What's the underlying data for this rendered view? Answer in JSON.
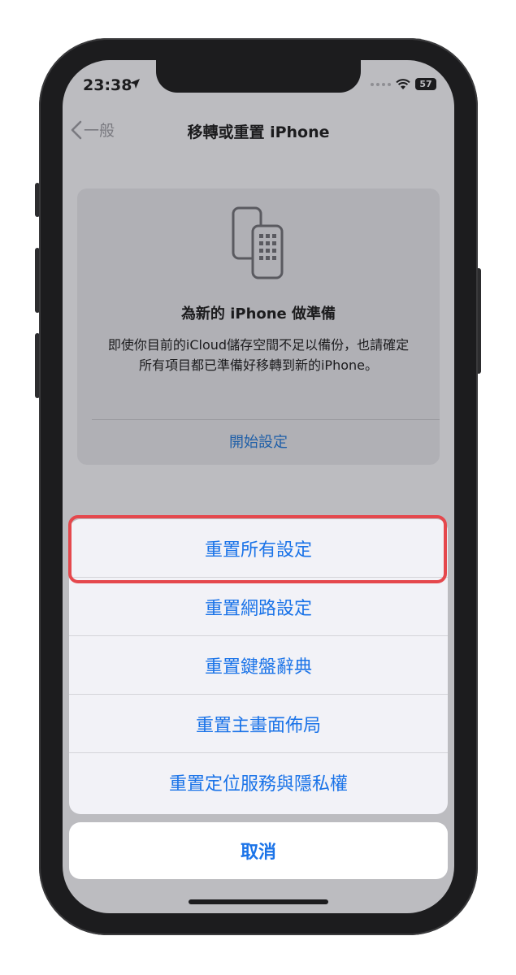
{
  "status_bar": {
    "time": "23:38",
    "battery": "57",
    "location_icon": "location-arrow-icon",
    "wifi_icon": "wifi-icon"
  },
  "nav": {
    "back_label": "一般",
    "title": "移轉或重置 iPhone",
    "back_icon": "chevron-left-icon"
  },
  "card": {
    "icon": "two-phones-icon",
    "title": "為新的 iPhone 做準備",
    "body": "即使你目前的iCloud儲存空間不足以備份，也請確定所有項目都已準備好移轉到新的iPhone。",
    "link": "開始設定"
  },
  "action_sheet": {
    "items": [
      {
        "label": "重置所有設定"
      },
      {
        "label": "重置網路設定"
      },
      {
        "label": "重置鍵盤辭典"
      },
      {
        "label": "重置主畫面佈局"
      },
      {
        "label": "重置定位服務與隱私權"
      }
    ],
    "cancel_label": "取消"
  },
  "colors": {
    "accent": "#1a73e8",
    "highlight": "#e5484d",
    "dim_background": "#bcbcc0"
  }
}
